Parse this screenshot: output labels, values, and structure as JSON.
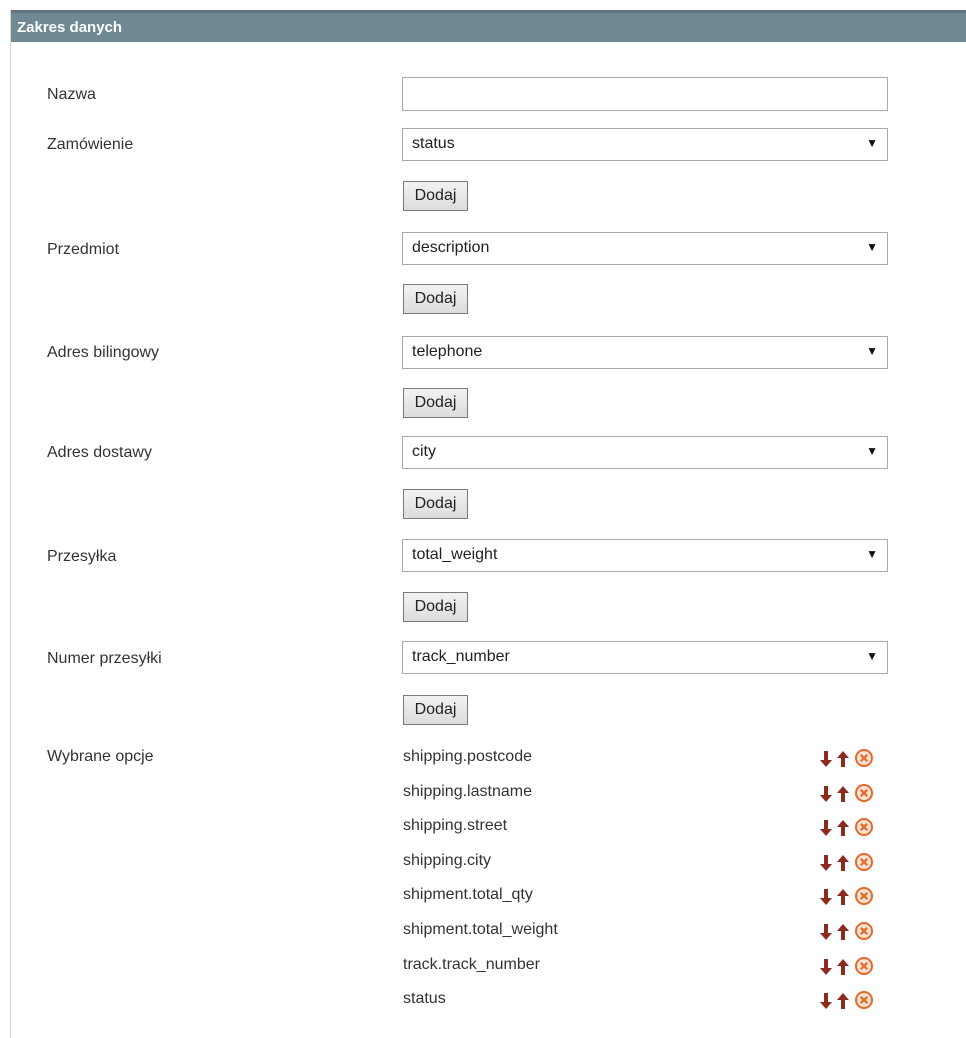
{
  "panel": {
    "title": "Zakres danych"
  },
  "fields": {
    "name": {
      "label": "Nazwa",
      "value": ""
    },
    "order": {
      "label": "Zamówienie",
      "selected": "status"
    },
    "item": {
      "label": "Przedmiot",
      "selected": "description"
    },
    "billing": {
      "label": "Adres bilingowy",
      "selected": "telephone"
    },
    "shipping": {
      "label": "Adres dostawy",
      "selected": "city"
    },
    "shipment": {
      "label": "Przesyłka",
      "selected": "total_weight"
    },
    "tracking": {
      "label": "Numer przesyłki",
      "selected": "track_number"
    }
  },
  "add_button_label": "Dodaj",
  "selected_options": {
    "label": "Wybrane opcje",
    "items": [
      "shipping.postcode",
      "shipping.lastname",
      "shipping.street",
      "shipping.city",
      "shipment.total_qty",
      "shipment.total_weight",
      "track.track_number",
      "status"
    ]
  },
  "icons": {
    "move_down": "arrow-down-icon",
    "move_up": "arrow-up-icon",
    "remove": "remove-circle-icon"
  },
  "colors": {
    "header_bg": "#6f8992",
    "icon_arrow": "#8b2a1f",
    "icon_remove": "#e8672a"
  }
}
